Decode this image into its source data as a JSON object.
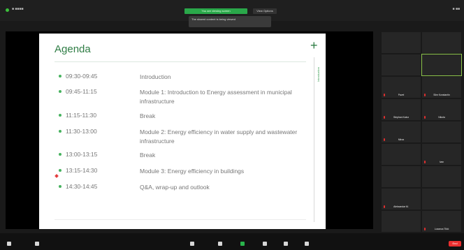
{
  "top_bar": {
    "recording_label": "■ ■■■■",
    "right_label": "■ ■■",
    "share_banner": "You are viewing screen",
    "view_option": "View Options",
    "notice": "The shared content is being viewed"
  },
  "slide": {
    "title": "Agenda",
    "side_label": "Introduction",
    "agenda": [
      {
        "time": "09:30-09:45",
        "desc": "Introduction"
      },
      {
        "time": "09:45-11:15",
        "desc": "Module 1: Introduction to Energy assessment in municipal infrastructure"
      },
      {
        "time": "11:15-11:30",
        "desc": "Break"
      },
      {
        "time": "11:30-13:00",
        "desc": "Module 2: Energy efficiency in water supply and wastewater infrastructure"
      },
      {
        "time": "13:00-13:15",
        "desc": "Break"
      },
      {
        "time": "13:15-14:30",
        "desc": "Module 3: Energy efficiency in buildings"
      },
      {
        "time": "14:30-14:45",
        "desc": "Q&A, wrap-up and outlook"
      }
    ],
    "footer": ""
  },
  "participants": [
    {
      "name": ""
    },
    {
      "name": ""
    },
    {
      "name": ""
    },
    {
      "name": ""
    },
    {
      "name": "Pavel"
    },
    {
      "name": "Siim Konstantin"
    },
    {
      "name": "Stephan Kainz"
    },
    {
      "name": "Nikola"
    },
    {
      "name": "Mirza"
    },
    {
      "name": ""
    },
    {
      "name": ""
    },
    {
      "name": "Ivan"
    },
    {
      "name": ""
    },
    {
      "name": ""
    },
    {
      "name": "Aleksandar M."
    },
    {
      "name": ""
    },
    {
      "name": ""
    },
    {
      "name": "Lozanca Tikić"
    }
  ],
  "bottom_bar": {
    "end_label": "End"
  }
}
